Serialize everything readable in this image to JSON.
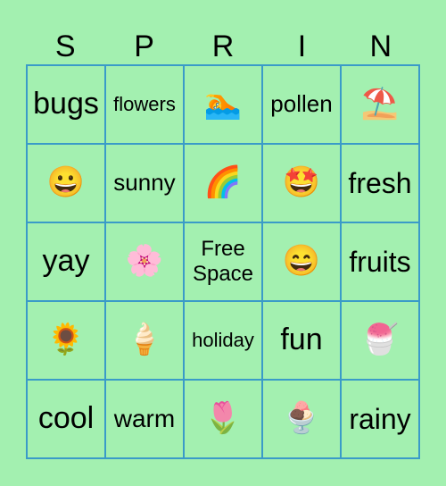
{
  "header": [
    "S",
    "P",
    "R",
    "I",
    "N"
  ],
  "cells": [
    {
      "text": "bugs",
      "size": 34
    },
    {
      "text": "flowers",
      "size": 22
    },
    {
      "text": "🏊",
      "emoji": true,
      "icon": "swimmer-icon"
    },
    {
      "text": "pollen",
      "size": 26
    },
    {
      "text": "⛱️",
      "emoji": true,
      "icon": "beach-umbrella-icon"
    },
    {
      "text": "😀",
      "emoji": true,
      "icon": "grinning-face-icon"
    },
    {
      "text": "sunny",
      "size": 26
    },
    {
      "text": "🌈",
      "emoji": true,
      "icon": "rainbow-icon"
    },
    {
      "text": "🤩",
      "emoji": true,
      "icon": "star-struck-icon"
    },
    {
      "text": "fresh",
      "size": 32
    },
    {
      "text": "yay",
      "size": 34
    },
    {
      "text": "🌸",
      "emoji": true,
      "icon": "cherry-blossom-icon"
    },
    {
      "text": "Free Space",
      "size": 24
    },
    {
      "text": "😄",
      "emoji": true,
      "icon": "smiling-face-icon"
    },
    {
      "text": "fruits",
      "size": 32
    },
    {
      "text": "🌻",
      "emoji": true,
      "icon": "sunflower-icon"
    },
    {
      "text": "🍦",
      "emoji": true,
      "icon": "soft-ice-cream-icon"
    },
    {
      "text": "holiday",
      "size": 22
    },
    {
      "text": "fun",
      "size": 34
    },
    {
      "text": "🍧",
      "emoji": true,
      "icon": "shaved-ice-icon"
    },
    {
      "text": "cool",
      "size": 34
    },
    {
      "text": "warm",
      "size": 28
    },
    {
      "text": "🌷",
      "emoji": true,
      "icon": "tulip-icon"
    },
    {
      "text": "🍨",
      "emoji": true,
      "icon": "ice-cream-sundae-icon"
    },
    {
      "text": "rainy",
      "size": 32
    }
  ]
}
